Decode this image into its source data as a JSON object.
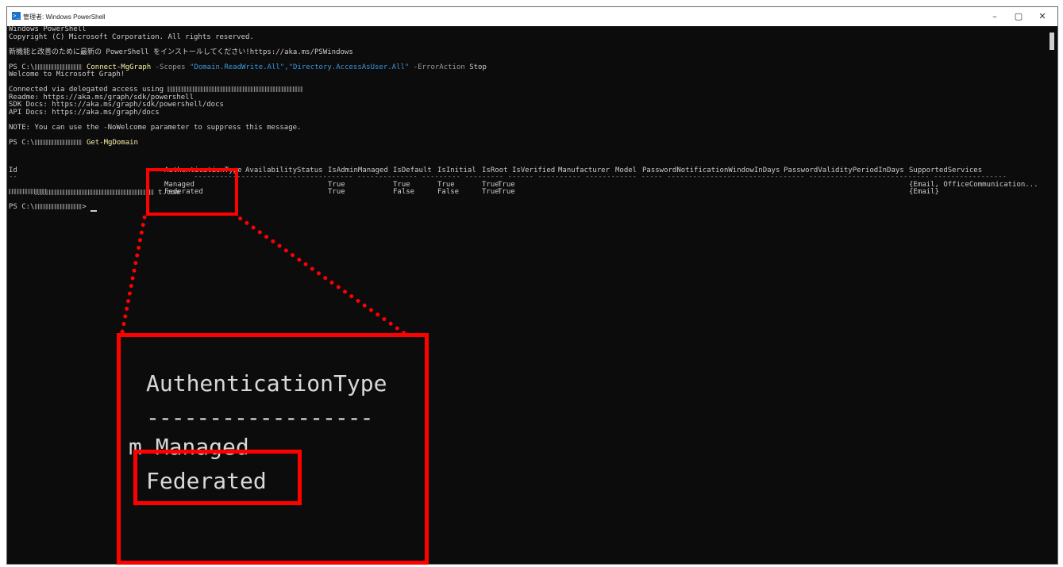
{
  "window": {
    "title": "管理者: Windows PowerShell",
    "icon": "powershell-icon",
    "controls": [
      "–",
      "▢",
      "✕"
    ]
  },
  "console": {
    "banner1": "Windows PowerShell",
    "banner2": "Copyright (C) Microsoft Corporation. All rights reserved.",
    "install_msg": "新機能と改善のために最新の PowerShell をインストールしてください!https://aka.ms/PSWindows",
    "cmd1_prompt": "PS C:\\",
    "cmd1_name": "Connect-MgGraph",
    "cmd1_param1": "-Scopes",
    "cmd1_value": "\"Domain.ReadWrite.All\",\"Directory.AccessAsUser.All\"",
    "cmd1_param2": "-ErrorAction",
    "cmd1_param2_value": "Stop",
    "welcome": "Welcome to Microsoft Graph!",
    "connected": "Connected via delegated access using ",
    "readme": "Readme: https://aka.ms/graph/sdk/powershell",
    "sdk_docs": "SDK Docs: https://aka.ms/graph/sdk/powershell/docs",
    "api_docs": "API Docs: https://aka.ms/graph/docs",
    "note": "NOTE: You can use the -NoWelcome parameter to suppress this message.",
    "cmd2_prompt": "PS C:\\",
    "cmd2_name": "Get-MgDomain",
    "final_prompt": "PS C:\\"
  },
  "table": {
    "headers": {
      "id": "Id",
      "auth": "AuthenticationType",
      "avail": "AvailabilityStatus",
      "admin": "IsAdminManaged",
      "default": "IsDefault",
      "initial": "IsInitial",
      "root": "IsRoot",
      "verified": "IsVerified",
      "manufacturer": "Manufacturer",
      "model": "Model",
      "pwnotify": "PasswordNotificationWindowInDays",
      "pwvalid": "PasswordValidityPeriodInDays",
      "services": "SupportedServices"
    },
    "rows": [
      {
        "id_suffix": "t.com",
        "auth": "Managed",
        "admin": "True",
        "default": "True",
        "initial": "True",
        "root": "True",
        "verified": "True",
        "services": "{Email, OfficeCommunication..."
      },
      {
        "id_suffix": "",
        "auth": "Federated",
        "admin": "True",
        "default": "False",
        "initial": "False",
        "root": "True",
        "verified": "True",
        "services": "{Email}"
      }
    ]
  },
  "zoom": {
    "header": "AuthenticationType",
    "dashes": "------------------",
    "row1_prefix": "m",
    "row1": "Managed",
    "row2": "Federated"
  }
}
